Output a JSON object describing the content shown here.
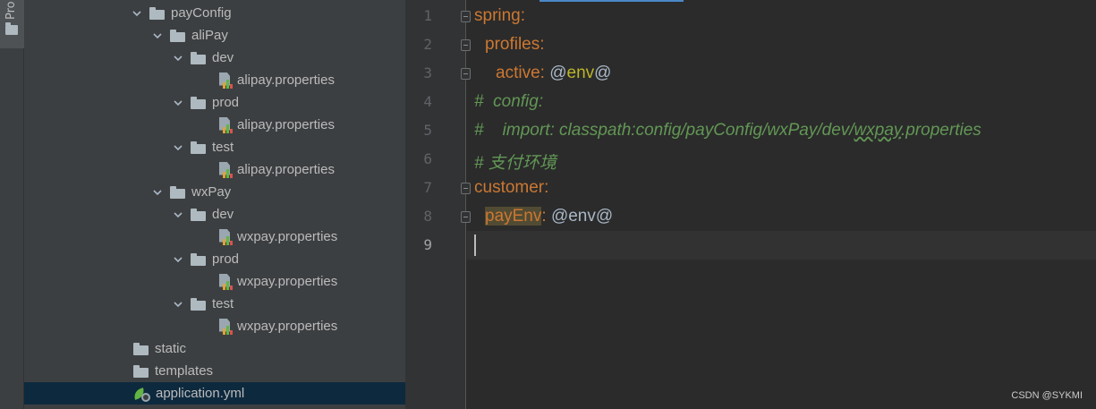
{
  "tool_window": {
    "label": "Pro"
  },
  "tree": {
    "items": [
      {
        "label": "payConfig",
        "type": "folder",
        "expanded": true
      },
      {
        "label": "aliPay",
        "type": "folder",
        "expanded": true
      },
      {
        "label": "dev",
        "type": "folder",
        "expanded": true
      },
      {
        "label": "alipay.properties",
        "type": "properties"
      },
      {
        "label": "prod",
        "type": "folder",
        "expanded": true
      },
      {
        "label": "alipay.properties",
        "type": "properties"
      },
      {
        "label": "test",
        "type": "folder",
        "expanded": true
      },
      {
        "label": "alipay.properties",
        "type": "properties"
      },
      {
        "label": "wxPay",
        "type": "folder",
        "expanded": true
      },
      {
        "label": "dev",
        "type": "folder",
        "expanded": true
      },
      {
        "label": "wxpay.properties",
        "type": "properties"
      },
      {
        "label": "prod",
        "type": "folder",
        "expanded": true
      },
      {
        "label": "wxpay.properties",
        "type": "properties"
      },
      {
        "label": "test",
        "type": "folder",
        "expanded": true
      },
      {
        "label": "wxpay.properties",
        "type": "properties"
      },
      {
        "label": "static",
        "type": "folder"
      },
      {
        "label": "templates",
        "type": "folder"
      },
      {
        "label": "application.yml",
        "type": "yml",
        "selected": true
      }
    ]
  },
  "editor": {
    "line_numbers": [
      "1",
      "2",
      "3",
      "4",
      "5",
      "6",
      "7",
      "8",
      "9"
    ],
    "current_line": "9",
    "lines": {
      "l1_key": "spring",
      "l1_colon": ":",
      "l2_key": "profiles",
      "l2_colon": ":",
      "l3_key": "active",
      "l3_colon": ":",
      "l3_at1": "@",
      "l3_env": "env",
      "l3_at2": "@",
      "l4": "#  config:",
      "l5_prefix": "#    import: classpath:config/payConfig/wxPay/dev/",
      "l5_squiggle": "wxpay",
      "l5_suffix": ".properties",
      "l6": "# 支付环境",
      "l7_key": "customer",
      "l7_colon": ":",
      "l8_key": "payEnv",
      "l8_colon": ":",
      "l8_value": "@env@"
    }
  },
  "watermark": "CSDN @SYKMI"
}
